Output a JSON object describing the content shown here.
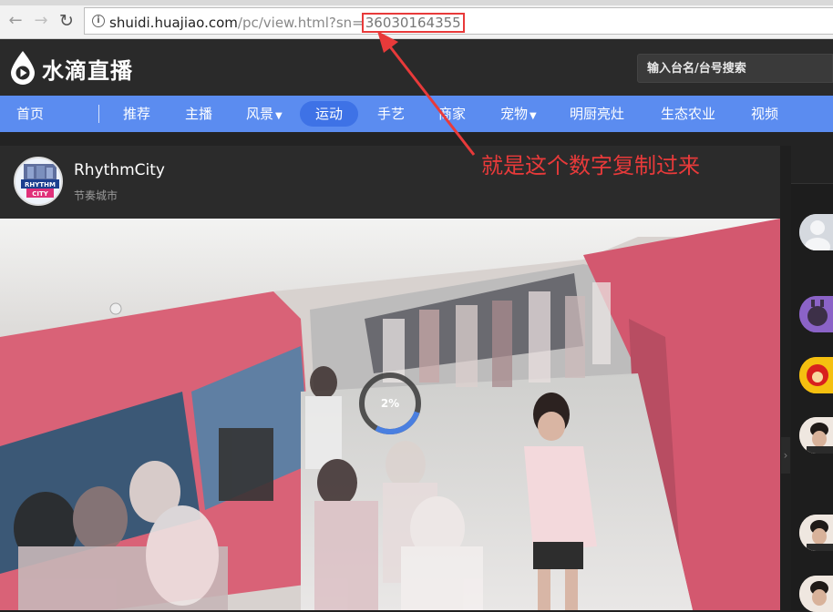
{
  "browser": {
    "back_icon": "arrow-left-icon",
    "forward_icon": "arrow-right-icon",
    "reload_icon": "reload-icon",
    "url_host": "shuidi.huajiao.com",
    "url_path": "/pc/view.html?sn=",
    "url_sn": "36030164355"
  },
  "site": {
    "logo_text": "水滴直播",
    "search_placeholder": "输入台名/台号搜索"
  },
  "nav": {
    "items": [
      {
        "label": "首页"
      },
      {
        "label": "推荐"
      },
      {
        "label": "主播"
      },
      {
        "label": "风景"
      },
      {
        "label": "运动",
        "active": true
      },
      {
        "label": "手艺"
      },
      {
        "label": "商家"
      },
      {
        "label": "宠物"
      },
      {
        "label": "明厨亮灶"
      },
      {
        "label": "生态农业"
      },
      {
        "label": "视频"
      }
    ]
  },
  "channel": {
    "name": "RhythmCity",
    "subtitle": "节奏城市",
    "avatar_text_1": "RHYTHM",
    "avatar_text_2": "CITY"
  },
  "player": {
    "loading_percent": "2%",
    "loading_fraction": 0.02
  },
  "annotation": {
    "text": "就是这个数字复制过来"
  },
  "colors": {
    "nav_bg": "#5b8cf0",
    "nav_active": "#3e72e6",
    "annotation_red": "#e83a3a"
  }
}
